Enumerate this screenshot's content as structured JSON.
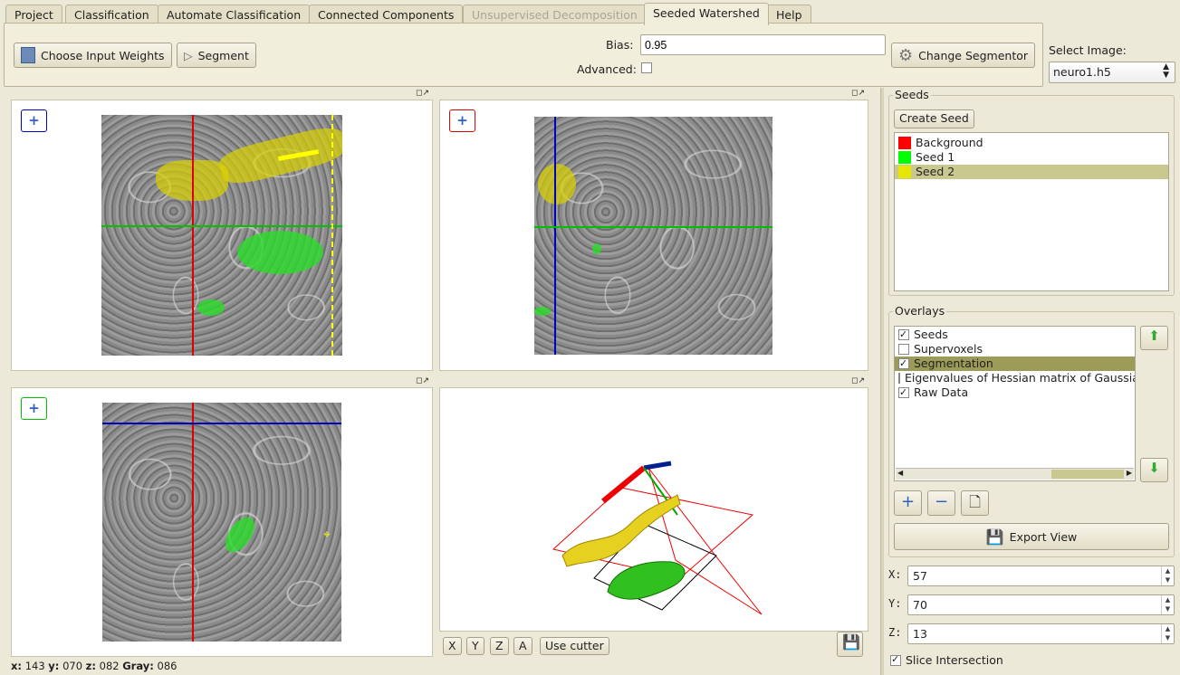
{
  "tabs": [
    {
      "label": "Project",
      "state": "normal"
    },
    {
      "label": "Classification",
      "state": "normal"
    },
    {
      "label": "Automate Classification",
      "state": "normal"
    },
    {
      "label": "Connected Components",
      "state": "normal"
    },
    {
      "label": "Unsupervised Decomposition",
      "state": "disabled"
    },
    {
      "label": "Seeded Watershed",
      "state": "active"
    },
    {
      "label": "Help",
      "state": "normal"
    }
  ],
  "toolbar": {
    "choose_weights_label": "Choose Input Weights",
    "segment_label": "Segment",
    "bias_label": "Bias:",
    "bias_value": "0.95",
    "advanced_label": "Advanced:",
    "advanced_checked": false,
    "change_segmentor_label": "Change Segmentor"
  },
  "select_image": {
    "label": "Select Image:",
    "value": "neuro1.h5"
  },
  "seeds": {
    "title": "Seeds",
    "create_label": "Create Seed",
    "items": [
      {
        "label": "Background",
        "color": "#ff0000",
        "selected": false
      },
      {
        "label": "Seed 1",
        "color": "#00ff00",
        "selected": false
      },
      {
        "label": "Seed 2",
        "color": "#e6e600",
        "selected": true
      }
    ]
  },
  "overlays": {
    "title": "Overlays",
    "items": [
      {
        "label": "Seeds",
        "checked": true,
        "selected": false
      },
      {
        "label": "Supervoxels",
        "checked": false,
        "selected": false
      },
      {
        "label": "Segmentation",
        "checked": true,
        "selected": true
      },
      {
        "label": "Eigenvalues of Hessian matrix of Gaussia",
        "checked": false,
        "selected": false
      },
      {
        "label": "Raw Data",
        "checked": true,
        "selected": false
      }
    ],
    "export_label": "Export View"
  },
  "coords": {
    "x_label": "X:",
    "x_value": "57",
    "y_label": "Y:",
    "y_value": "70",
    "z_label": "Z:",
    "z_value": "13"
  },
  "slice_intersection": {
    "label": "Slice Intersection",
    "checked": true
  },
  "view3d": {
    "x_label": "X",
    "y_label": "Y",
    "z_label": "Z",
    "a_label": "A",
    "cutter_label": "Use cutter"
  },
  "status": {
    "x_label": "x:",
    "x_value": "143",
    "y_label": "y:",
    "y_value": "070",
    "z_label": "z:",
    "z_value": "082",
    "gray_label": "Gray:",
    "gray_value": "086"
  },
  "colors": {
    "accent_selected": "#c9c98f",
    "overlay_selected": "#9c9c58",
    "crosshair_red": "#e00000",
    "crosshair_green": "#00c000",
    "crosshair_blue": "#0000c0"
  }
}
